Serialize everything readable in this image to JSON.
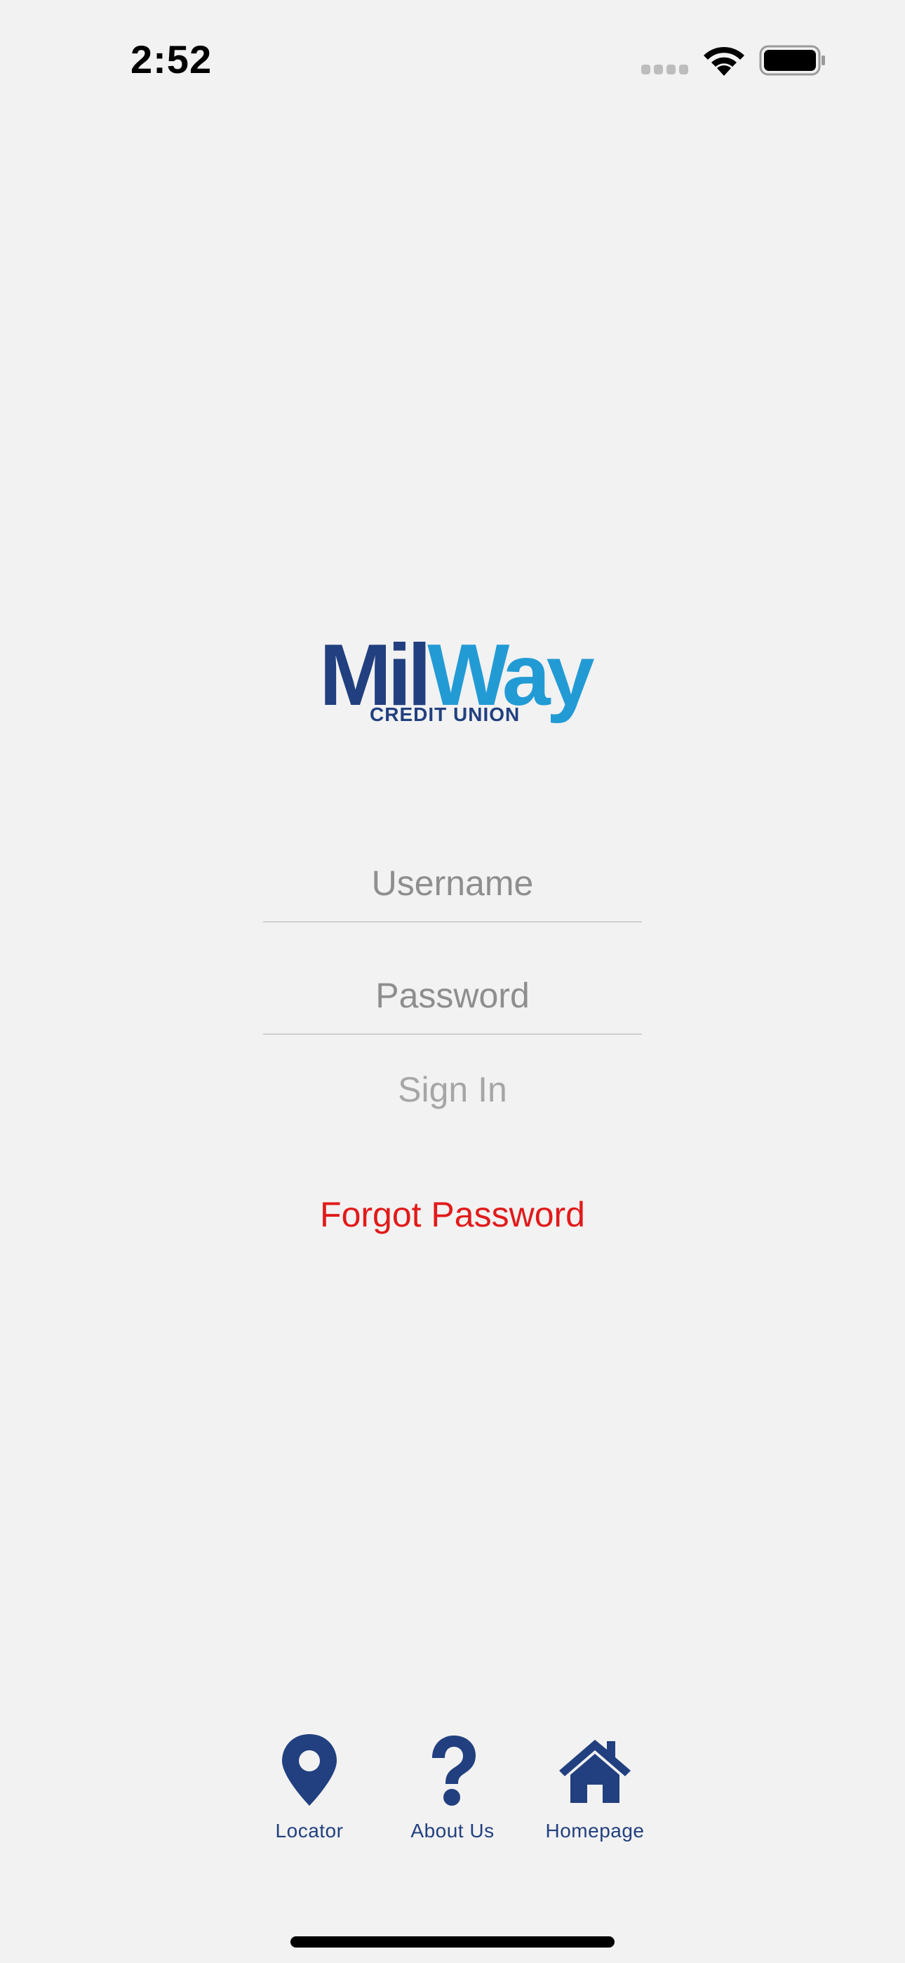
{
  "status_bar": {
    "time": "2:52"
  },
  "logo": {
    "word_part1": "Mil",
    "word_part2": "Way",
    "subtitle": "CREDIT UNION"
  },
  "login_form": {
    "username_placeholder": "Username",
    "password_placeholder": "Password",
    "sign_in_label": "Sign In",
    "forgot_password_label": "Forgot Password"
  },
  "bottom_nav": {
    "items": [
      {
        "label": "Locator",
        "icon": "map-pin-icon"
      },
      {
        "label": "About Us",
        "icon": "question-mark-icon"
      },
      {
        "label": "Homepage",
        "icon": "house-icon"
      }
    ]
  },
  "colors": {
    "background": "#f2f2f2",
    "brand_navy": "#22407f",
    "brand_blue": "#229bd5",
    "forgot_red": "#e21a1a",
    "placeholder_gray": "#8e8e8e",
    "disabled_gray": "#a6a6a6"
  }
}
